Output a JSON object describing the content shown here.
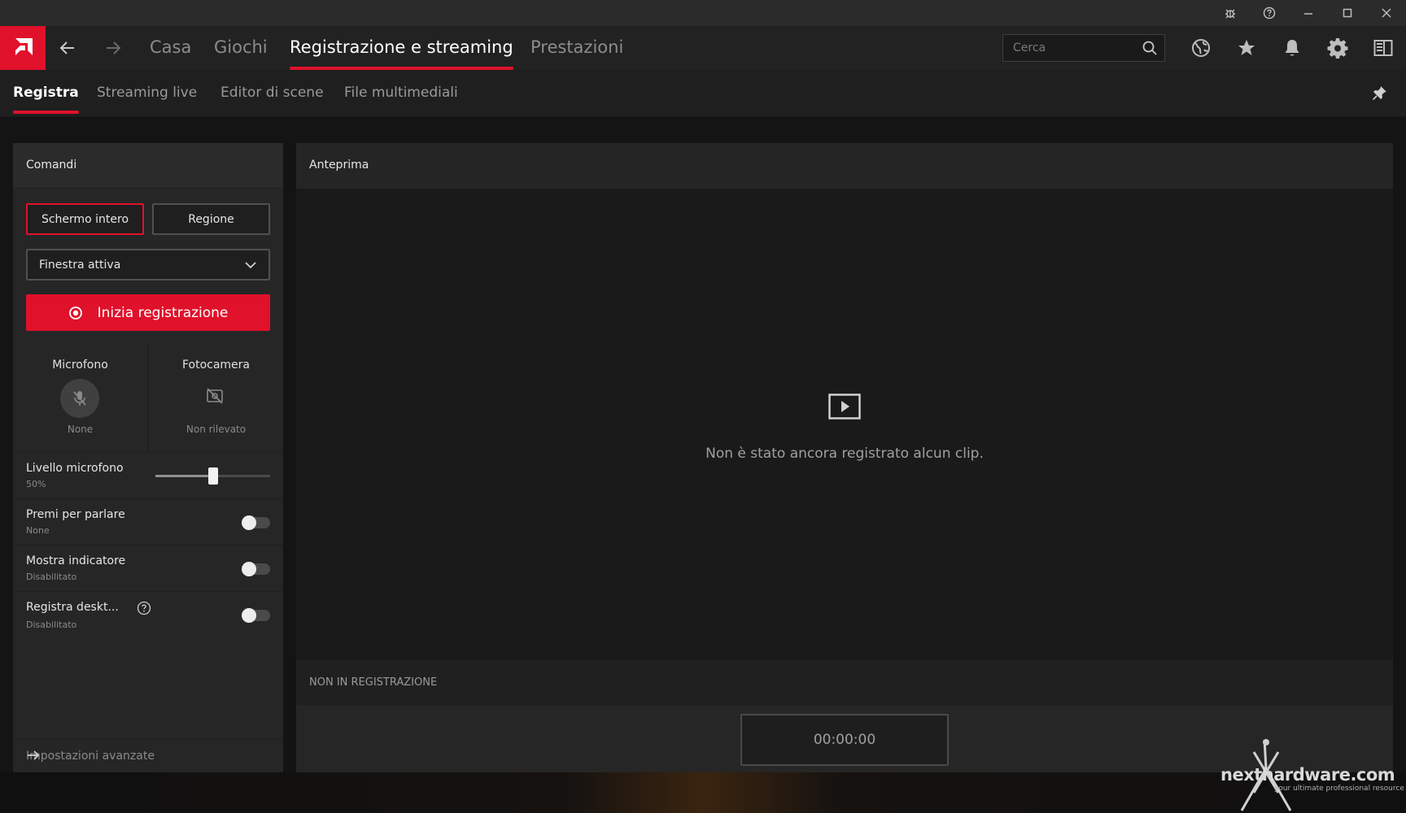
{
  "app": {
    "nav_tabs": [
      {
        "label": "Casa"
      },
      {
        "label": "Giochi"
      },
      {
        "label": "Registrazione e streaming"
      },
      {
        "label": "Prestazioni"
      }
    ],
    "search_placeholder": "Cerca",
    "accent_color": "#e0112b"
  },
  "sub_tabs": [
    {
      "label": "Registra"
    },
    {
      "label": "Streaming live"
    },
    {
      "label": "Editor di scene"
    },
    {
      "label": "File multimediali"
    }
  ],
  "controls": {
    "title": "Comandi",
    "full_screen_label": "Schermo intero",
    "region_label": "Regione",
    "window_select_value": "Finestra attiva",
    "record_button_label": "Inizia registrazione",
    "microphone": {
      "label": "Microfono",
      "status": "None"
    },
    "camera": {
      "label": "Fotocamera",
      "status": "Non rilevato"
    },
    "mic_level": {
      "label": "Livello microfono",
      "value_text": "50%",
      "value": 0.5
    },
    "push_to_talk": {
      "label": "Premi per parlare",
      "value": "None",
      "enabled": false
    },
    "show_indicator": {
      "label": "Mostra indicatore",
      "value": "Disabilitato",
      "enabled": false
    },
    "record_desktop": {
      "label": "Registra deskt...",
      "value": "Disabilitato",
      "enabled": false
    },
    "advanced_label": "Impostazioni avanzate"
  },
  "preview": {
    "title": "Anteprima",
    "empty_message": "Non è stato ancora registrato alcun clip.",
    "status": "NON IN REGISTRAZIONE",
    "timer": "00:00:00"
  },
  "watermark": {
    "text": "nexthardware.com",
    "tagline": "your ultimate professional resource"
  }
}
